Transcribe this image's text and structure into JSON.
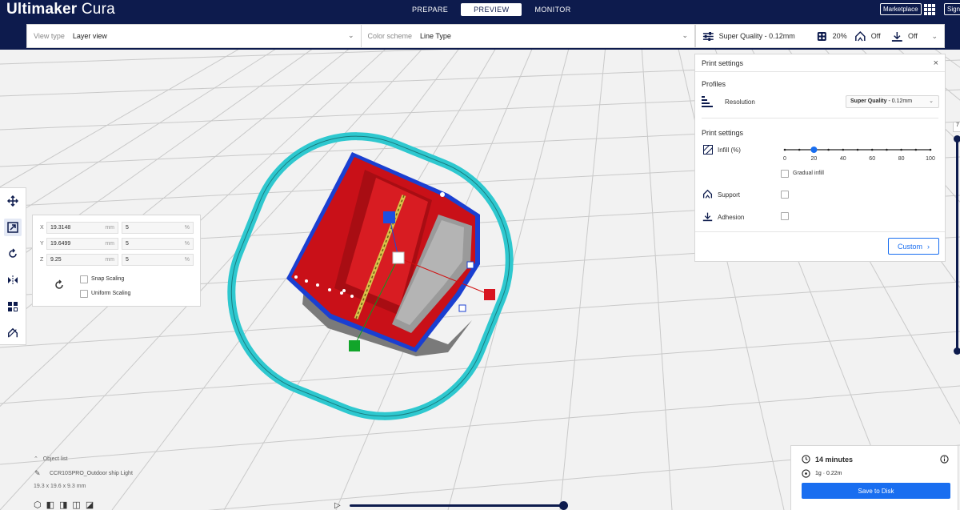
{
  "app": {
    "logo_bold": "Ultimaker",
    "logo_light": " Cura"
  },
  "stages": [
    {
      "label": "PREPARE"
    },
    {
      "label": "PREVIEW"
    },
    {
      "label": "MONITOR"
    }
  ],
  "header_buttons": {
    "marketplace": "Marketplace",
    "signin": "Sign"
  },
  "view": {
    "view_type_label": "View type",
    "view_type_value": "Layer view",
    "color_scheme_label": "Color scheme",
    "color_scheme_value": "Line Type"
  },
  "quick_settings": {
    "profile": "Super Quality - 0.12mm",
    "infill": "20%",
    "support": "Off",
    "adhesion": "Off"
  },
  "print_settings": {
    "title": "Print settings",
    "profiles_heading": "Profiles",
    "resolution_label": "Resolution",
    "resolution_value_bold": "Super Quality",
    "resolution_value_rest": " - 0.12mm",
    "settings_heading": "Print settings",
    "infill_label": "Infill (%)",
    "infill_value": 20,
    "infill_ticks": [
      "0",
      "20",
      "40",
      "60",
      "80",
      "100"
    ],
    "gradual_infill": "Gradual infill",
    "support_label": "Support",
    "adhesion_label": "Adhesion",
    "custom_button": "Custom"
  },
  "scale_tool": {
    "x_axis": "X",
    "x_mm": "19.3148",
    "x_pct": "5",
    "y_axis": "Y",
    "y_mm": "19.6499",
    "y_pct": "5",
    "z_axis": "Z",
    "z_mm": "9.25",
    "z_pct": "5",
    "mm_unit": "mm",
    "pct_unit": "%",
    "snap_scaling": "Snap Scaling",
    "uniform_scaling": "Uniform Scaling"
  },
  "object": {
    "list_label": "Object list",
    "name": "CCR10SPRO_Outdoor ship Light",
    "dimensions": "19.3 x 19.6 x 9.3 mm"
  },
  "layer_number": "7",
  "print_info": {
    "time": "14 minutes",
    "material": "1g · 0.22m",
    "save_button": "Save to Disk"
  },
  "colors": {
    "brand_navy": "#0d1b4d",
    "accent_blue": "#196ef0",
    "model_red": "#d2141b",
    "skirt_cyan": "#2ec8cf"
  }
}
